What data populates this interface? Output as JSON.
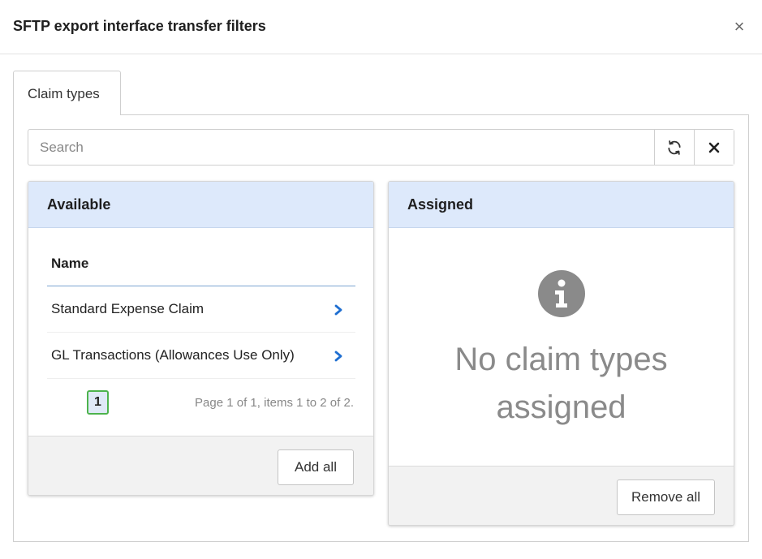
{
  "dialog": {
    "title": "SFTP export interface transfer filters",
    "close_symbol": "×"
  },
  "tabs": [
    {
      "label": "Claim types",
      "active": true
    }
  ],
  "search": {
    "placeholder": "Search",
    "value": ""
  },
  "available": {
    "title": "Available",
    "column_header": "Name",
    "rows": [
      {
        "name": "Standard Expense Claim"
      },
      {
        "name": "GL Transactions (Allowances Use Only)"
      }
    ],
    "pagination": {
      "current_page": "1",
      "info": "Page 1 of 1, items 1 to 2 of 2."
    },
    "add_all_label": "Add all"
  },
  "assigned": {
    "title": "Assigned",
    "empty_message": "No claim types assigned",
    "remove_all_label": "Remove all"
  },
  "colors": {
    "panel_header_bg": "#dde9fb",
    "chevron": "#1f6fd1",
    "page_active_border": "#4db34d",
    "info_icon": "#8a8a8a"
  }
}
